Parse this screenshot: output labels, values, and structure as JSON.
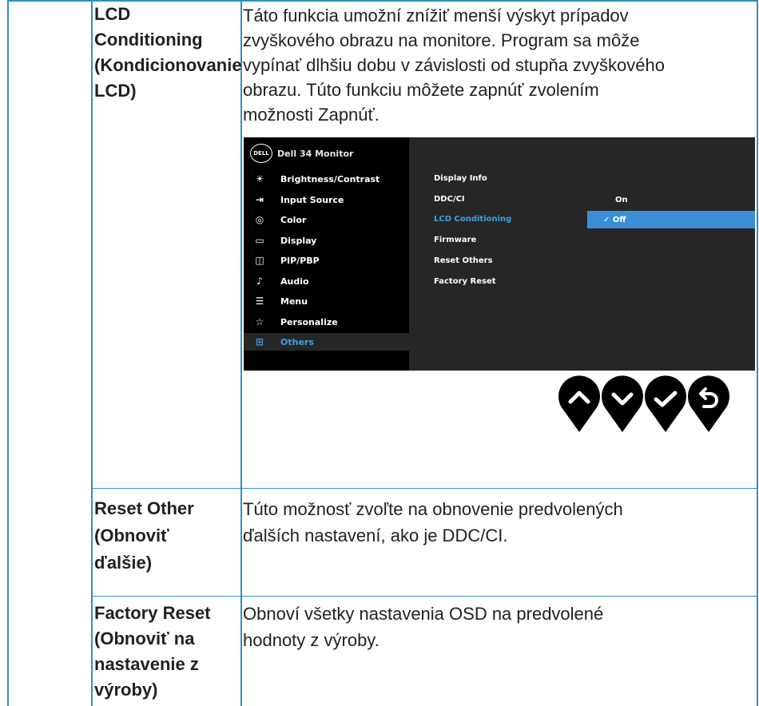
{
  "rows": [
    {
      "label_lines": [
        "LCD",
        "Conditioning",
        "(Kondicionovanie",
        "LCD)"
      ],
      "desc_lines": [
        "Táto funkcia umožní znížiť menší výskyt prípadov",
        "zvyškového obrazu na monitore. Program sa môže",
        "vypínať dlhšiu dobu v závislosti od stupňa zvyškového",
        "obrazu. Túto funkciu môžete zapnúť zvolením",
        "možnosti Zapnúť."
      ]
    },
    {
      "label_lines": [
        "Reset Other",
        "(Obnoviť",
        "ďalšie)"
      ],
      "desc_lines": [
        "Túto možnosť zvoľte na obnovenie predvolených",
        "ďalších nastavení, ako je DDC/CI."
      ]
    },
    {
      "label_lines": [
        "Factory Reset",
        "(Obnoviť na",
        "nastavenie z",
        "výroby)"
      ],
      "desc_lines": [
        "Obnoví všetky nastavenia OSD na predvolené",
        "hodnoty z výroby."
      ]
    }
  ],
  "osd": {
    "logo": "DELL",
    "title": "Dell 34 Monitor",
    "menu": [
      {
        "label": "Brightness/Contrast",
        "icon": "☀"
      },
      {
        "label": "Input Source",
        "icon": "⇥"
      },
      {
        "label": "Color",
        "icon": "◎"
      },
      {
        "label": "Display",
        "icon": "▭"
      },
      {
        "label": "PIP/PBP",
        "icon": "◫"
      },
      {
        "label": "Audio",
        "icon": "♪"
      },
      {
        "label": "Menu",
        "icon": "☰"
      },
      {
        "label": "Personalize",
        "icon": "☆"
      },
      {
        "label": "Others",
        "icon": "⊞"
      }
    ],
    "submenu": [
      "Display Info",
      "DDC/CI",
      "LCD Conditioning",
      "Firmware",
      "Reset Others",
      "Factory Reset"
    ],
    "options": {
      "on": "On",
      "off": "✓ Off"
    }
  },
  "buttons": [
    "up-icon",
    "down-icon",
    "check-icon",
    "back-icon"
  ],
  "colors": {
    "table_line": "#2e8fc3",
    "osd_highlight": "#3b8fd6",
    "osd_active_text": "#3fa0dd"
  }
}
